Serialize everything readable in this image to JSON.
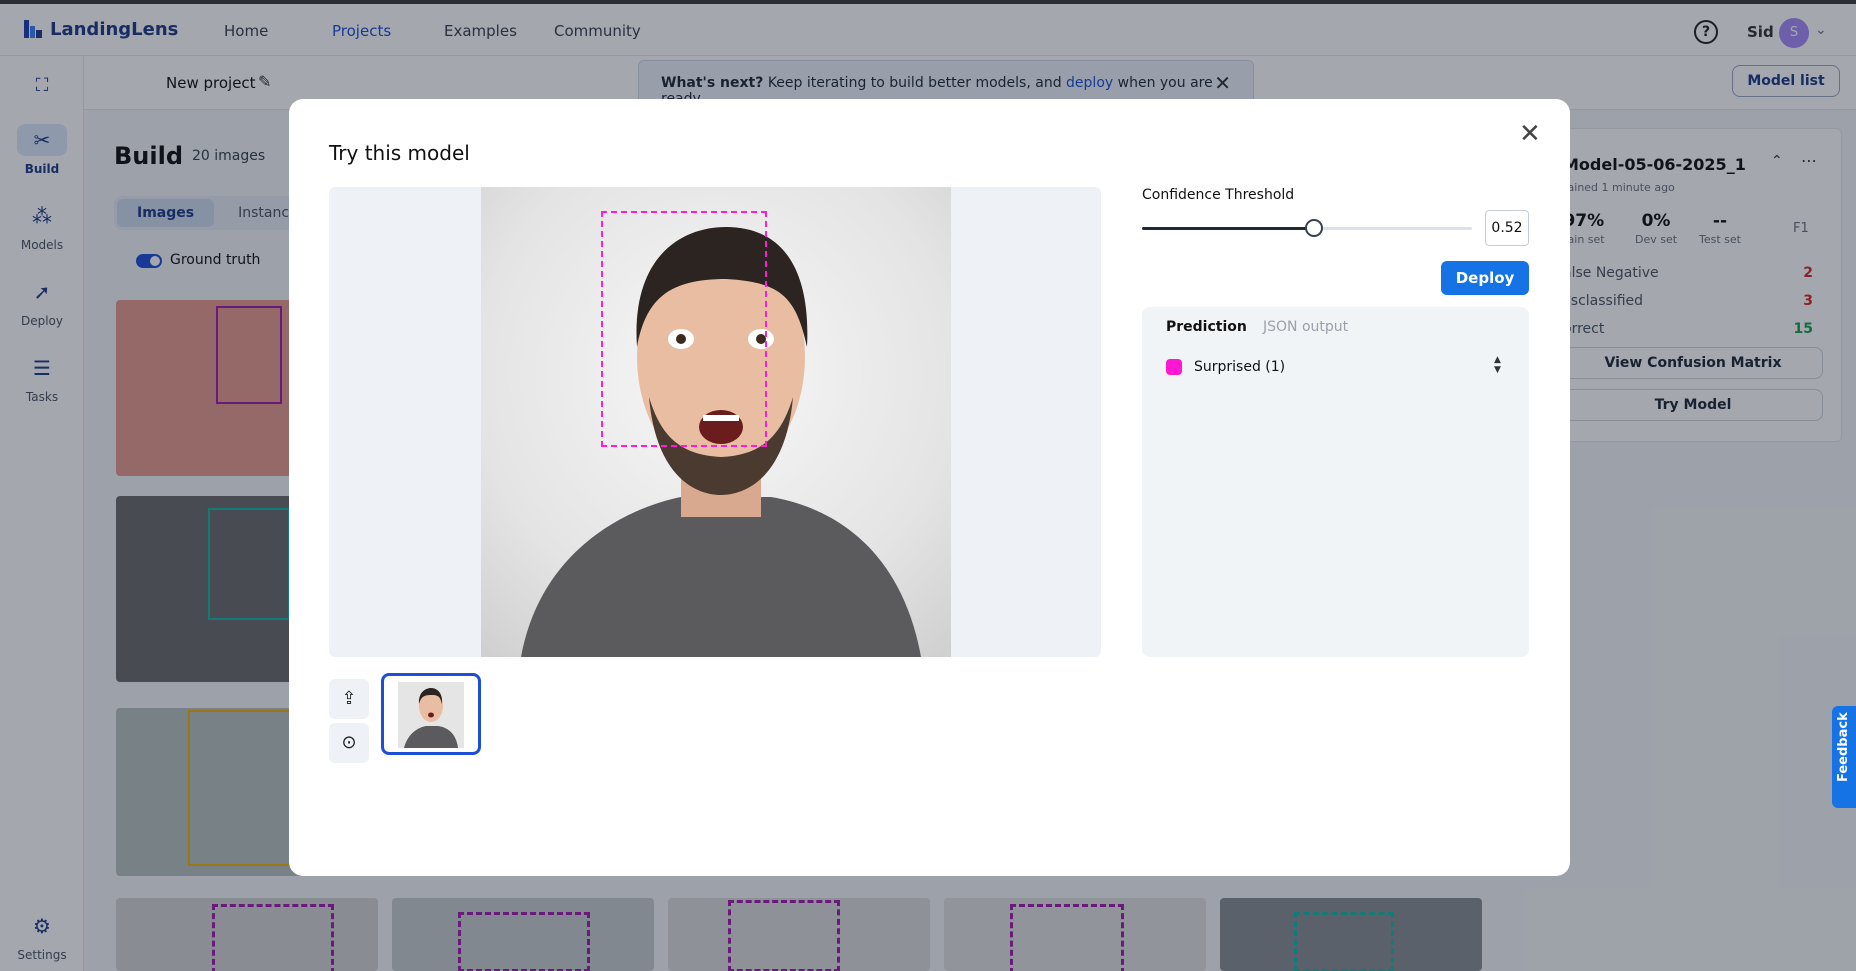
{
  "app": {
    "name": "LandingLens"
  },
  "nav": {
    "items": [
      {
        "label": "Home"
      },
      {
        "label": "Projects"
      },
      {
        "label": "Examples"
      },
      {
        "label": "Community"
      }
    ]
  },
  "user": {
    "name": "Sid",
    "initial": "S"
  },
  "project": {
    "title": "New project",
    "banner_lead": "What's next?",
    "banner_text": "Keep iterating to build better models, and",
    "banner_link": "deploy",
    "banner_tail": "when you are ready.",
    "model_list_label": "Model list"
  },
  "sidebar": {
    "items": [
      {
        "label": "Build",
        "icon": "build-icon"
      },
      {
        "label": "Models",
        "icon": "models-icon"
      },
      {
        "label": "Deploy",
        "icon": "rocket-icon"
      },
      {
        "label": "Tasks",
        "icon": "tasks-icon"
      }
    ],
    "settings_label": "Settings"
  },
  "build": {
    "title": "Build",
    "image_count": "20 images",
    "tabs": [
      {
        "label": "Images"
      },
      {
        "label": "Instances"
      }
    ],
    "ground_truth_label": "Ground truth"
  },
  "model_panel": {
    "name": "Model-05-06-2025_1",
    "subtitle": "rained 1 minute ago",
    "metrics": [
      {
        "value": "97%",
        "label": "rain set"
      },
      {
        "value": "0%",
        "label": "Dev set"
      },
      {
        "value": "--",
        "label": "Test set"
      }
    ],
    "f1_label": "F1",
    "rows": [
      {
        "label": "alse Negative",
        "count": "2"
      },
      {
        "label": "lisclassified",
        "count": "3"
      },
      {
        "label": "orrect",
        "count": "15"
      }
    ],
    "view_matrix_label": "View Confusion Matrix",
    "try_model_label": "Try Model"
  },
  "modal": {
    "title": "Try this model",
    "confidence_label": "Confidence Threshold",
    "confidence_value": "0.52",
    "confidence": 0.52,
    "deploy_label": "Deploy",
    "tabs": [
      {
        "label": "Prediction"
      },
      {
        "label": "JSON output"
      }
    ],
    "predictions": [
      {
        "label": "Surprised (1)",
        "color": "#ff17d1"
      }
    ]
  },
  "feedback_label": "Feedback"
}
